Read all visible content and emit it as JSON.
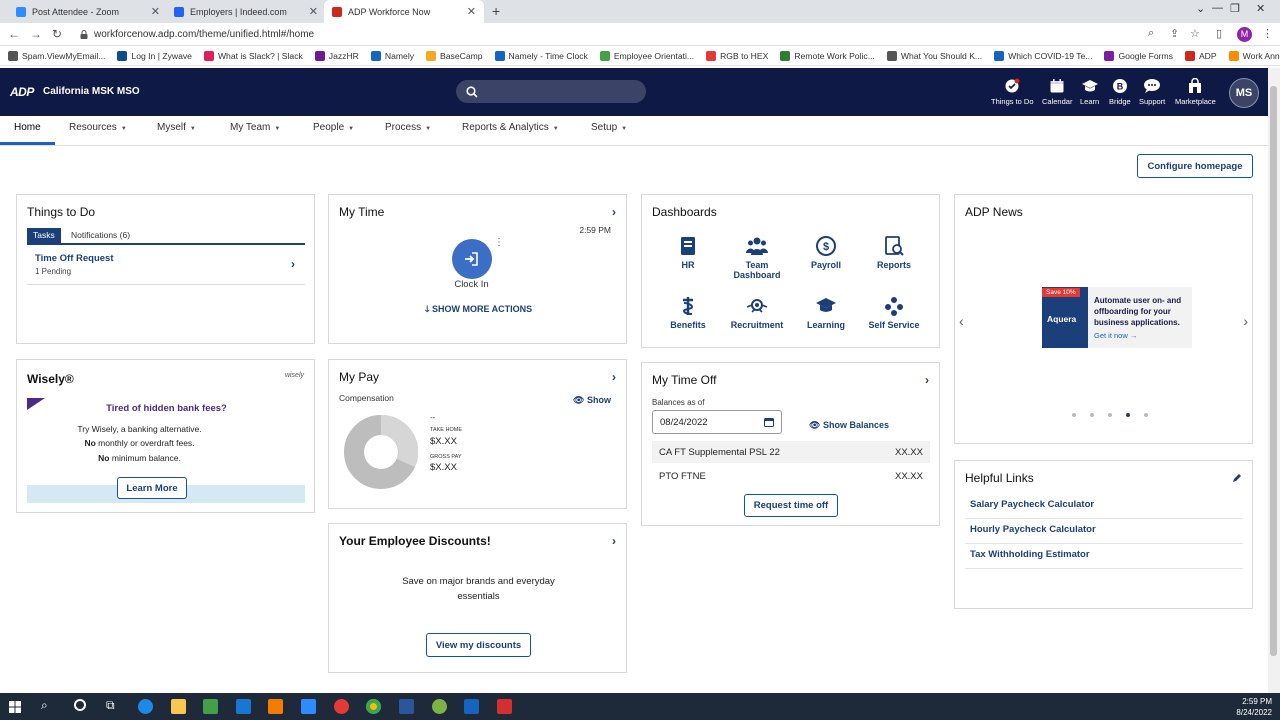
{
  "browser": {
    "tabs": [
      {
        "label": "Post Attendee - Zoom",
        "color": "#2d8cff"
      },
      {
        "label": "Employers | Indeed.com",
        "color": "#2164f3"
      },
      {
        "label": "ADP Workforce Now",
        "color": "#d0271d"
      }
    ],
    "url": "workforcenow.adp.com/theme/unified.html#/home",
    "profile_initial": "M",
    "bookmarks": [
      {
        "label": "Spam.ViewMyEmail...",
        "color": "#555"
      },
      {
        "label": "Log In | Zywave",
        "color": "#0a4d8c"
      },
      {
        "label": "What is Slack? | Slack",
        "color": "#e01e5a"
      },
      {
        "label": "JazzHR",
        "color": "#6a1b9a"
      },
      {
        "label": "Namely",
        "color": "#1565c0"
      },
      {
        "label": "BaseCamp",
        "color": "#f9a825"
      },
      {
        "label": "Namely - Time Clock",
        "color": "#1565c0"
      },
      {
        "label": "Employee Orientati...",
        "color": "#43a047"
      },
      {
        "label": "RGB to HEX",
        "color": "#e53935"
      },
      {
        "label": "Remote Work Polic...",
        "color": "#2e7d32"
      },
      {
        "label": "What You Should K...",
        "color": "#555"
      },
      {
        "label": "Which COVID-19 Te...",
        "color": "#1565c0"
      },
      {
        "label": "Google Forms",
        "color": "#7b1fa2"
      },
      {
        "label": "ADP",
        "color": "#d0271d"
      },
      {
        "label": "Work Anniversary T...",
        "color": "#fb8c00"
      }
    ]
  },
  "header": {
    "logo": "ADP",
    "company": "California MSK MSO",
    "nav": [
      {
        "label": "Things to Do",
        "icon": "checklist-icon"
      },
      {
        "label": "Calendar",
        "icon": "calendar-icon"
      },
      {
        "label": "Learn",
        "icon": "graduation-cap-icon"
      },
      {
        "label": "Bridge",
        "icon": "bridge-icon"
      },
      {
        "label": "Support",
        "icon": "chat-bubble-icon"
      },
      {
        "label": "Marketplace",
        "icon": "store-icon"
      }
    ],
    "avatar": "MS"
  },
  "menu": [
    "Home",
    "Resources",
    "Myself",
    "My Team",
    "People",
    "Process",
    "Reports & Analytics",
    "Setup"
  ],
  "configure_label": "Configure homepage",
  "things_to_do": {
    "title": "Things to Do",
    "tab_tasks": "Tasks",
    "tab_notifications": "Notifications (6)",
    "item_title": "Time Off Request",
    "item_sub": "1 Pending"
  },
  "my_time": {
    "title": "My Time",
    "time": "2:59 PM",
    "clock_label": "Clock In",
    "more_actions": "SHOW MORE ACTIONS"
  },
  "dashboards": {
    "title": "Dashboards",
    "items": [
      "HR",
      "Team Dashboard",
      "Payroll",
      "Reports",
      "Benefits",
      "Recruitment",
      "Learning",
      "Self Service"
    ]
  },
  "news": {
    "title": "ADP News",
    "badge": "Save 10%",
    "brand": "Aquera",
    "text": "Automate user on- and offboarding for your business applications.",
    "cta": "Get it now →",
    "dots_active": 4,
    "dots_total": 5
  },
  "wisely": {
    "title": "Wisely®",
    "logo": "wisely",
    "headline": "Tired of hidden bank fees?",
    "line1": "Try Wisely, a banking alternative.",
    "line2_bold": "No",
    "line2": " monthly or overdraft fees.",
    "line3_bold": "No",
    "line3": " minimum balance.",
    "button": "Learn More"
  },
  "my_pay": {
    "title": "My Pay",
    "subtitle": "Compensation",
    "show": "Show",
    "dash": "--",
    "take_home_label": "TAKE HOME",
    "take_home_value": "$X.XX",
    "gross_label": "GROSS PAY",
    "gross_value": "$X.XX"
  },
  "time_off": {
    "title": "My Time Off",
    "balances_label": "Balances as of",
    "date": "08/24/2022",
    "show_balances": "Show Balances",
    "rows": [
      {
        "name": "CA FT Supplemental PSL 22",
        "value": "XX.XX"
      },
      {
        "name": "PTO FTNE",
        "value": "XX.XX"
      }
    ],
    "button": "Request time off"
  },
  "helpful_links": {
    "title": "Helpful Links",
    "links": [
      "Salary Paycheck Calculator",
      "Hourly Paycheck Calculator",
      "Tax Withholding Estimator"
    ]
  },
  "discounts": {
    "title": "Your Employee Discounts!",
    "text1": "Save on major brands and everyday",
    "text2": "essentials",
    "button": "View my discounts"
  },
  "taskbar": {
    "time": "2:59 PM",
    "date": "8/24/2022"
  }
}
